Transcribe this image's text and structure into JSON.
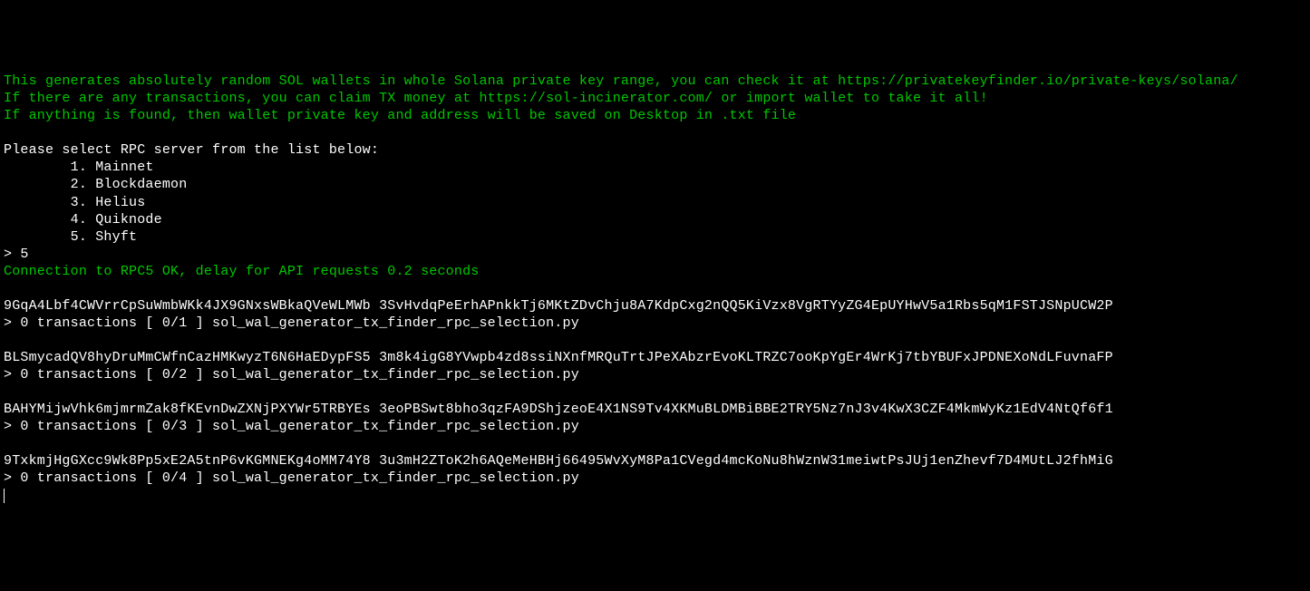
{
  "header": {
    "line1": "This generates absolutely random SOL wallets in whole Solana private key range, you can check it at https://privatekeyfinder.io/private-keys/solana/",
    "line2": "If there are any transactions, you can claim TX money at https://sol-incinerator.com/ or import wallet to take it all!",
    "line3": "If anything is found, then wallet private key and address will be saved on Desktop in .txt file"
  },
  "prompt": {
    "title": "Please select RPC server from the list below:",
    "options": [
      "        1. Mainnet",
      "        2. Blockdaemon",
      "        3. Helius",
      "        4. Quiknode",
      "        5. Shyft"
    ],
    "input": "> 5"
  },
  "connection": "Connection to RPC5 OK, delay for API requests 0.2 seconds",
  "entries": [
    {
      "keys": "9GqA4Lbf4CWVrrCpSuWmbWKk4JX9GNxsWBkaQVeWLMWb 3SvHvdqPeErhAPnkkTj6MKtZDvChju8A7KdpCxg2nQQ5KiVzx8VgRTYyZG4EpUYHwV5a1Rbs5qM1FSTJSNpUCW2P",
      "status": "> 0 transactions [ 0/1 ] sol_wal_generator_tx_finder_rpc_selection.py"
    },
    {
      "keys": "BLSmycadQV8hyDruMmCWfnCazHMKwyzT6N6HaEDypFS5 3m8k4igG8YVwpb4zd8ssiNXnfMRQuTrtJPeXAbzrEvoKLTRZC7ooKpYgEr4WrKj7tbYBUFxJPDNEXoNdLFuvnaFP",
      "status": "> 0 transactions [ 0/2 ] sol_wal_generator_tx_finder_rpc_selection.py"
    },
    {
      "keys": "BAHYMijwVhk6mjmrmZak8fKEvnDwZXNjPXYWr5TRBYEs 3eoPBSwt8bho3qzFA9DShjzeoE4X1NS9Tv4XKMuBLDMBiBBE2TRY5Nz7nJ3v4KwX3CZF4MkmWyKz1EdV4NtQf6f1",
      "status": "> 0 transactions [ 0/3 ] sol_wal_generator_tx_finder_rpc_selection.py"
    },
    {
      "keys": "9TxkmjHgGXcc9Wk8Pp5xE2A5tnP6vKGMNEKg4oMM74Y8 3u3mH2ZToK2h6AQeMeHBHj66495WvXyM8Pa1CVegd4mcKoNu8hWznW31meiwtPsJUj1enZhevf7D4MUtLJ2fhMiG",
      "status": "> 0 transactions [ 0/4 ] sol_wal_generator_tx_finder_rpc_selection.py"
    }
  ]
}
